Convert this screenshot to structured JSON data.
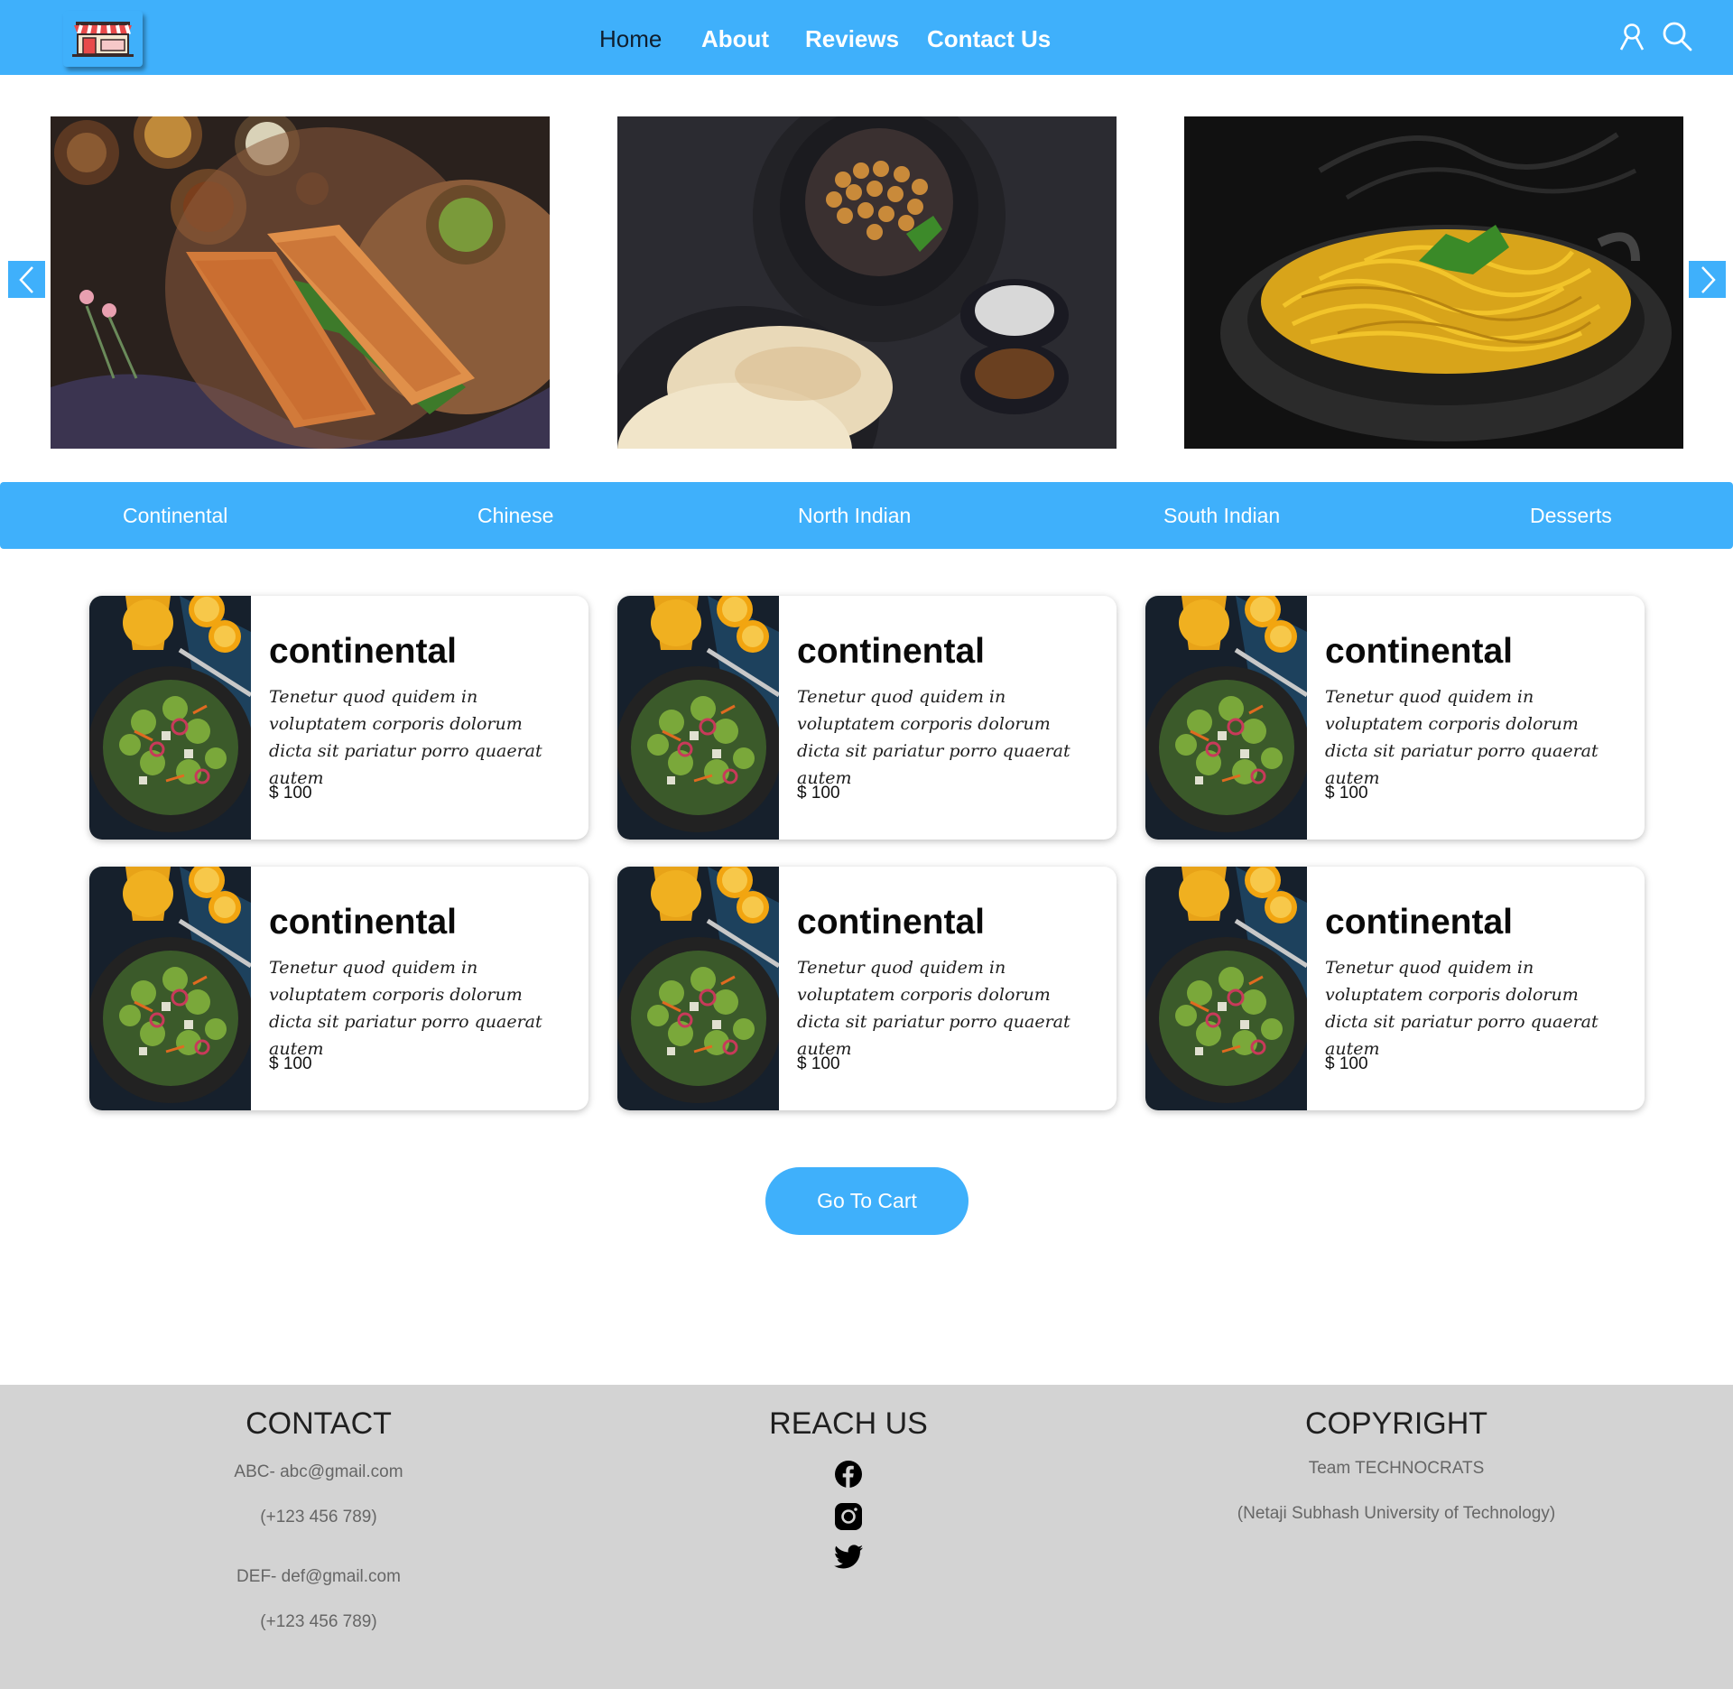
{
  "nav": {
    "links": [
      "Home",
      "About",
      "Reviews",
      "Contact Us"
    ],
    "active": "Home"
  },
  "icons": {
    "logo": "shop-storefront-icon",
    "user": "user-icon",
    "search": "search-icon",
    "prev": "chevron-left-icon",
    "next": "chevron-right-icon",
    "facebook": "facebook-icon",
    "instagram": "instagram-icon",
    "twitter": "twitter-icon"
  },
  "carousel": {
    "slides": [
      "dosa-photo",
      "chole-bhature-photo",
      "noodles-photo"
    ]
  },
  "categories": [
    "Continental",
    "Chinese",
    "North Indian",
    "South Indian",
    "Desserts"
  ],
  "cards": [
    {
      "title": "continental",
      "description": "Tenetur quod quidem in voluptatem corporis dolorum dicta sit pariatur porro quaerat autem",
      "price": "$ 100"
    },
    {
      "title": "continental",
      "description": "Tenetur quod quidem in voluptatem corporis dolorum dicta sit pariatur porro quaerat autem",
      "price": "$ 100"
    },
    {
      "title": "continental",
      "description": "Tenetur quod quidem in voluptatem corporis dolorum dicta sit pariatur porro quaerat autem",
      "price": "$ 100"
    },
    {
      "title": "continental",
      "description": "Tenetur quod quidem in voluptatem corporis dolorum dicta sit pariatur porro quaerat autem",
      "price": "$ 100"
    },
    {
      "title": "continental",
      "description": "Tenetur quod quidem in voluptatem corporis dolorum dicta sit pariatur porro quaerat autem",
      "price": "$ 100"
    },
    {
      "title": "continental",
      "description": "Tenetur quod quidem in voluptatem corporis dolorum dicta sit pariatur porro quaerat autem",
      "price": "$ 100"
    }
  ],
  "cart_button": "Go To Cart",
  "footer": {
    "contact": {
      "heading": "CONTACT",
      "email1": "ABC- abc@gmail.com",
      "phone1": "(+123 456 789)",
      "email2": "DEF- def@gmail.com",
      "phone2": "(+123 456 789)"
    },
    "reach": {
      "heading": "REACH US"
    },
    "copyright": {
      "heading": "COPYRIGHT",
      "team": "Team TECHNOCRATS",
      "university": "(Netaji Subhash University of Technology)"
    }
  },
  "colors": {
    "accent": "#3fb0fb",
    "footer_bg": "#d3d3d3",
    "nav_active": "#0f1e2e"
  }
}
